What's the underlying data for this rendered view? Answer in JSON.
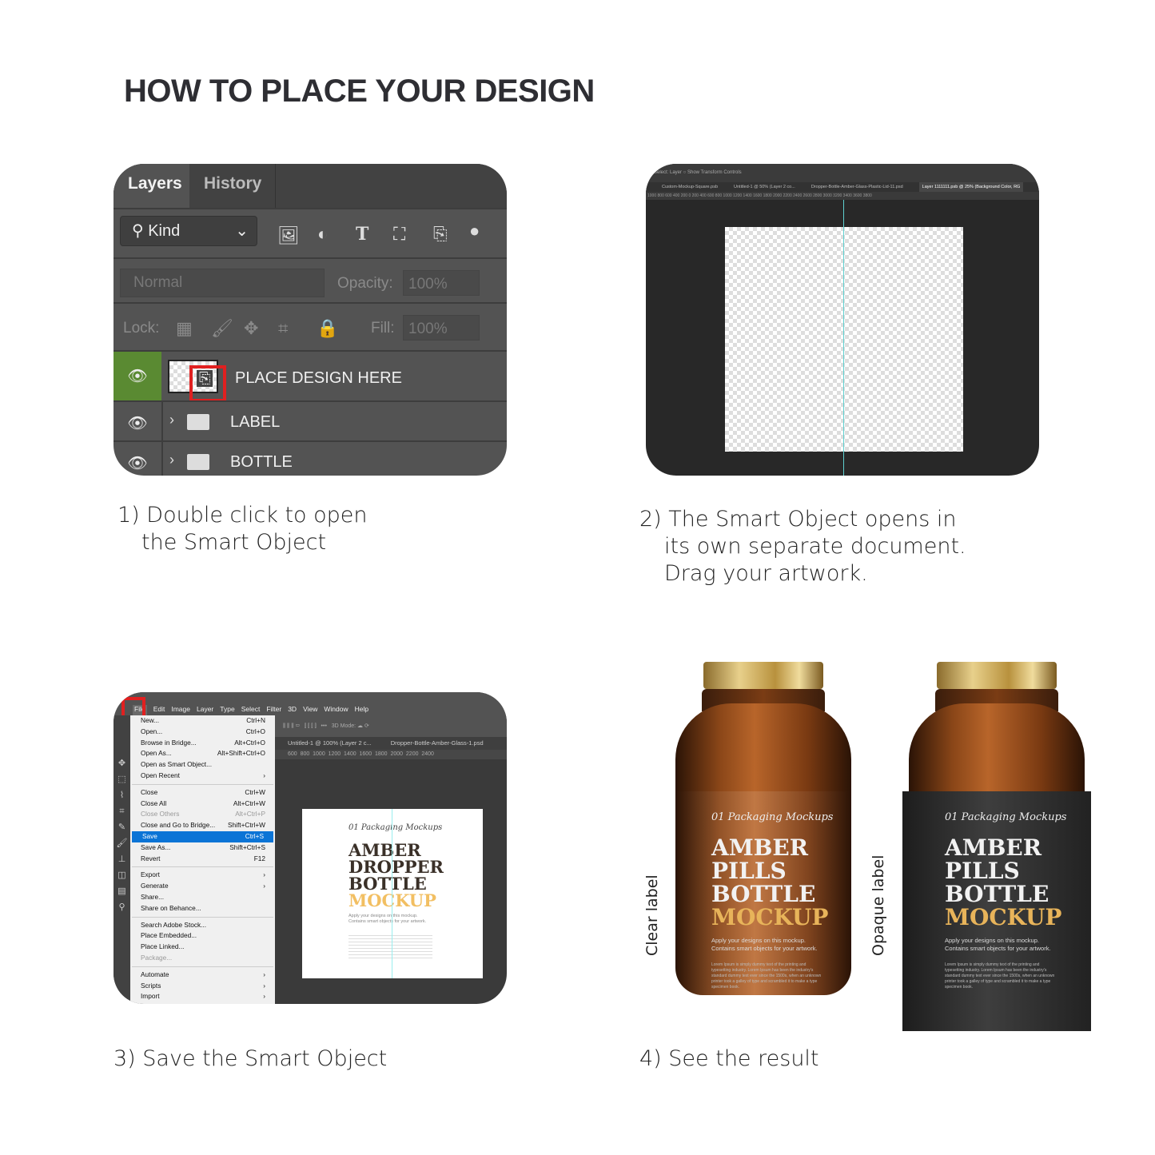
{
  "title": "HOW TO PLACE YOUR DESIGN",
  "steps": [
    {
      "caption_line1": "1) Double click to open",
      "caption_line2": "the Smart Object"
    },
    {
      "caption_line1": "2) The Smart Object opens in",
      "caption_line2": "its own separate document.",
      "caption_line3": "Drag your artwork."
    },
    {
      "caption_line1": "3) Save the Smart Object"
    },
    {
      "caption_line1": "4) See the result"
    }
  ],
  "layers_panel": {
    "tabs": [
      "Layers",
      "History"
    ],
    "filter": "Kind",
    "blend_mode": "Normal",
    "opacity_label": "Opacity:",
    "opacity": "100%",
    "lock_label": "Lock:",
    "fill_label": "Fill:",
    "fill": "100%",
    "layers": [
      "PLACE DESIGN HERE",
      "LABEL",
      "BOTTLE"
    ],
    "highlight_color": "#e02020",
    "active_eye_color": "#5a8a32"
  },
  "smart_object_doc": {
    "toolbar": "Select: Layer  ○ Show Transform Controls",
    "tabs": [
      "Custom-Mockup-Square.psb",
      "Untitled-1 @ 50% (Layer 2 co...",
      "Dropper-Bottle-Amber-Glass-Plastic-Lid-11.psd",
      "Layer 1111111.psb @ 25% (Background Color, RG"
    ],
    "ruler": "1000 800 600 400 200 0 200 400 600 800 1000 1200 1400 1600 1800 2000 2200 2400 2600 2800 3000 3200 3400 3600 3800"
  },
  "file_menu": {
    "menubar": [
      "File",
      "Edit",
      "Image",
      "Layer",
      "Type",
      "Select",
      "Filter",
      "3D",
      "View",
      "Window",
      "Help"
    ],
    "tabs": [
      "Untitled-1 @ 100% (Layer 2 c...",
      "Dropper-Bottle-Amber-Glass-1.psd"
    ],
    "ruler": "600  800  1000  1200  1400  1600  1800  2000  2200  2400",
    "groups": [
      [
        {
          "label": "New...",
          "key": "Ctrl+N"
        },
        {
          "label": "Open...",
          "key": "Ctrl+O"
        },
        {
          "label": "Browse in Bridge...",
          "key": "Alt+Ctrl+O"
        },
        {
          "label": "Open As...",
          "key": "Alt+Shift+Ctrl+O"
        },
        {
          "label": "Open as Smart Object...",
          "key": ""
        },
        {
          "label": "Open Recent",
          "key": "›"
        }
      ],
      [
        {
          "label": "Close",
          "key": "Ctrl+W"
        },
        {
          "label": "Close All",
          "key": "Alt+Ctrl+W"
        },
        {
          "label": "Close Others",
          "key": "Alt+Ctrl+P"
        },
        {
          "label": "Close and Go to Bridge...",
          "key": "Shift+Ctrl+W"
        },
        {
          "label": "Save",
          "key": "Ctrl+S"
        },
        {
          "label": "Save As...",
          "key": "Shift+Ctrl+S"
        },
        {
          "label": "Revert",
          "key": "F12"
        }
      ],
      [
        {
          "label": "Export",
          "key": "›"
        },
        {
          "label": "Generate",
          "key": "›"
        },
        {
          "label": "Share...",
          "key": ""
        },
        {
          "label": "Share on Behance...",
          "key": ""
        }
      ],
      [
        {
          "label": "Search Adobe Stock...",
          "key": ""
        },
        {
          "label": "Place Embedded...",
          "key": ""
        },
        {
          "label": "Place Linked...",
          "key": ""
        },
        {
          "label": "Package...",
          "key": ""
        }
      ],
      [
        {
          "label": "Automate",
          "key": "›"
        },
        {
          "label": "Scripts",
          "key": "›"
        },
        {
          "label": "Import",
          "key": "›"
        }
      ]
    ],
    "selected": "Save",
    "disabled": [
      "Close Others",
      "Package..."
    ],
    "doc": {
      "script": "01 Packaging Mockups",
      "lines": [
        "AMBER",
        "DROPPER",
        "BOTTLE"
      ],
      "accent": "MOCKUP",
      "sub1": "Apply your designs on this mockup.",
      "sub2": "Contains smart objects for your artwork."
    }
  },
  "result": {
    "clear_label": "Clear label",
    "opaque_label": "Opaque label",
    "bottle_script": "01 Packaging Mockups",
    "bottle_lines": [
      "AMBER",
      "PILLS",
      "BOTTLE"
    ],
    "bottle_accent": "MOCKUP",
    "bottle_sub1": "Apply your designs on this mockup.",
    "bottle_sub2": "Contains smart objects for your artwork.",
    "bottle_body": "Lorem Ipsum is simply dummy text of the printing and typesetting industry. Lorem Ipsum has been the industry's standard dummy text ever since the 1500s, when an unknown printer took a galley of type and scrambled it to make a type specimen book.",
    "accent_color": "#e8b45a"
  }
}
